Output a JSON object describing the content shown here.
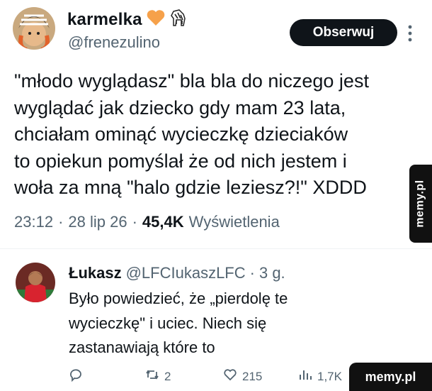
{
  "tweet": {
    "display_name": "karmelka",
    "handle": "@frenezulino",
    "follow_label": "Obserwuj",
    "text": "\"młodo wyglądasz\" bla bla do niczego jest\nwyglądać jak dziecko gdy mam 23 lata,\nchciałam ominąć wycieczkę dzieciaków\nto opiekun pomyślał że od nich jestem i\nwoła za mną \"halo gdzie leziesz?!\" XDDD",
    "time": "23:12",
    "date": "28 lip 26",
    "views_count": "45,4K",
    "views_label": "Wyświetlenia",
    "sep": "·",
    "name_icons": [
      "orange-heart-icon",
      "zebra-icon"
    ],
    "colors": {
      "heart": "#f6a14a",
      "follow_bg": "#0f1419",
      "secondary_text": "#536471"
    }
  },
  "reply": {
    "display_name": "Łukasz",
    "handle": "@LFCIukaszLFC",
    "age": "3 g.",
    "sep": "·",
    "text": "Było powiedzieć, że „pierdolę te\nwycieczkę\" i uciec. Niech się\nzastanawiają które to",
    "actions": {
      "replies": "",
      "retweets": "2",
      "likes": "215",
      "views": "1,7K"
    }
  },
  "watermark": {
    "side_label": "memy.pl",
    "bottom_label": "memy.pl"
  }
}
